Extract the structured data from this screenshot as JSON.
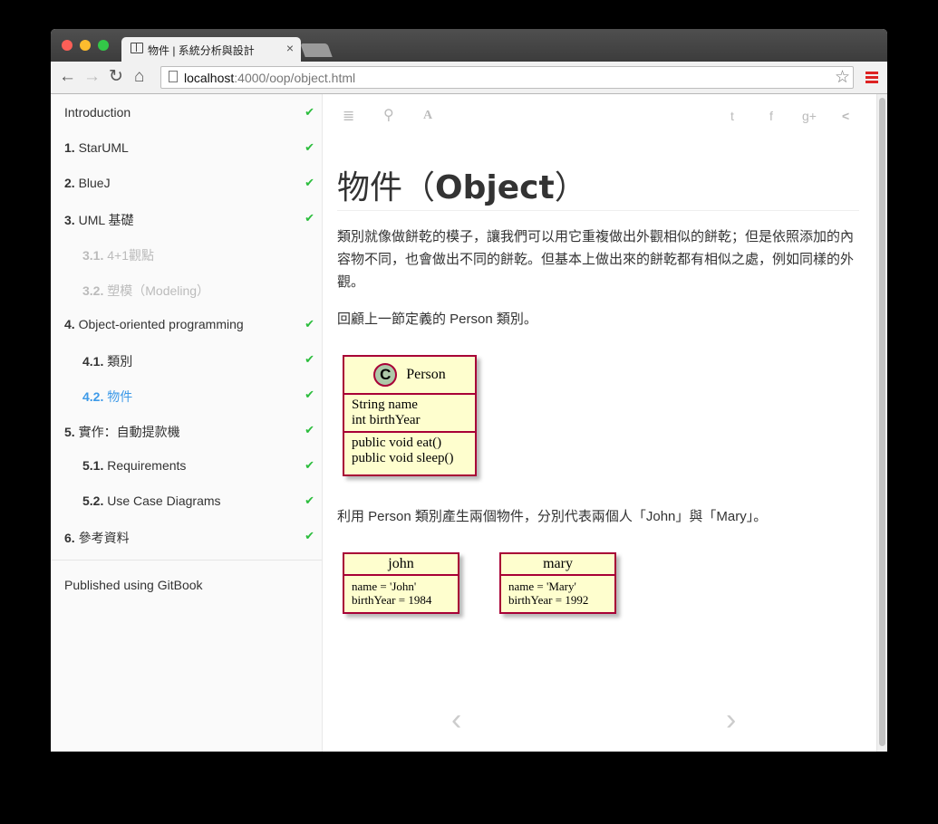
{
  "browser": {
    "tab_title": "物件 | 系統分析與設計",
    "tab_close": "×",
    "url_host": "localhost",
    "url_path": ":4000/oop/object.html",
    "back": "←",
    "forward": "→",
    "reload": "↻",
    "home": "⌂",
    "star": "☆"
  },
  "sidebar": {
    "items": [
      {
        "num": "",
        "label": "Introduction",
        "check": "✔"
      },
      {
        "num": "1.",
        "label": " StarUML",
        "check": "✔"
      },
      {
        "num": "2.",
        "label": " BlueJ",
        "check": "✔"
      },
      {
        "num": "3.",
        "label": " UML 基礎",
        "check": "✔"
      },
      {
        "num": "3.1.",
        "label": " 4+1觀點",
        "check": ""
      },
      {
        "num": "3.2.",
        "label": " 塑模（Modeling）",
        "check": ""
      },
      {
        "num": "4.",
        "label": " Object-oriented programming",
        "check": "✔"
      },
      {
        "num": "4.1.",
        "label": " 類別",
        "check": "✔"
      },
      {
        "num": "4.2.",
        "label": " 物件",
        "check": "✔"
      },
      {
        "num": "5.",
        "label": " 實作：自動提款機",
        "check": "✔"
      },
      {
        "num": "5.1.",
        "label": " Requirements",
        "check": "✔"
      },
      {
        "num": "5.2.",
        "label": " Use Case Diagrams",
        "check": "✔"
      },
      {
        "num": "6.",
        "label": " 參考資料",
        "check": "✔"
      }
    ],
    "published": "Published using GitBook"
  },
  "toolbar_icons": {
    "menu": "≣",
    "search": "⚲",
    "font": "A",
    "twitter": "t",
    "facebook": "f",
    "google": "g+",
    "share": "<"
  },
  "content": {
    "title_cn": "物件（",
    "title_en": "Object",
    "title_close": "）",
    "para1": "類別就像做餅乾的模子，讓我們可以用它重複做出外觀相似的餅乾；但是依照添加的內容物不同，也會做出不同的餅乾。但基本上做出來的餅乾都有相似之處，例如同樣的外觀。",
    "para2": "回顧上一節定義的 Person 類別。",
    "para3": "利用 Person 類別產生兩個物件，分別代表兩個人「John」與「Mary」。",
    "prev": "‹",
    "next": "›"
  },
  "uml_class": {
    "badge": "C",
    "name": "Person",
    "fields": [
      "String name",
      "int birthYear"
    ],
    "methods": [
      "public void eat()",
      "public void sleep()"
    ]
  },
  "uml_objects": [
    {
      "name": "john",
      "lines": [
        "name = 'John'",
        "birthYear = 1984"
      ]
    },
    {
      "name": "mary",
      "lines": [
        "name = 'Mary'",
        "birthYear = 1992"
      ]
    }
  ]
}
